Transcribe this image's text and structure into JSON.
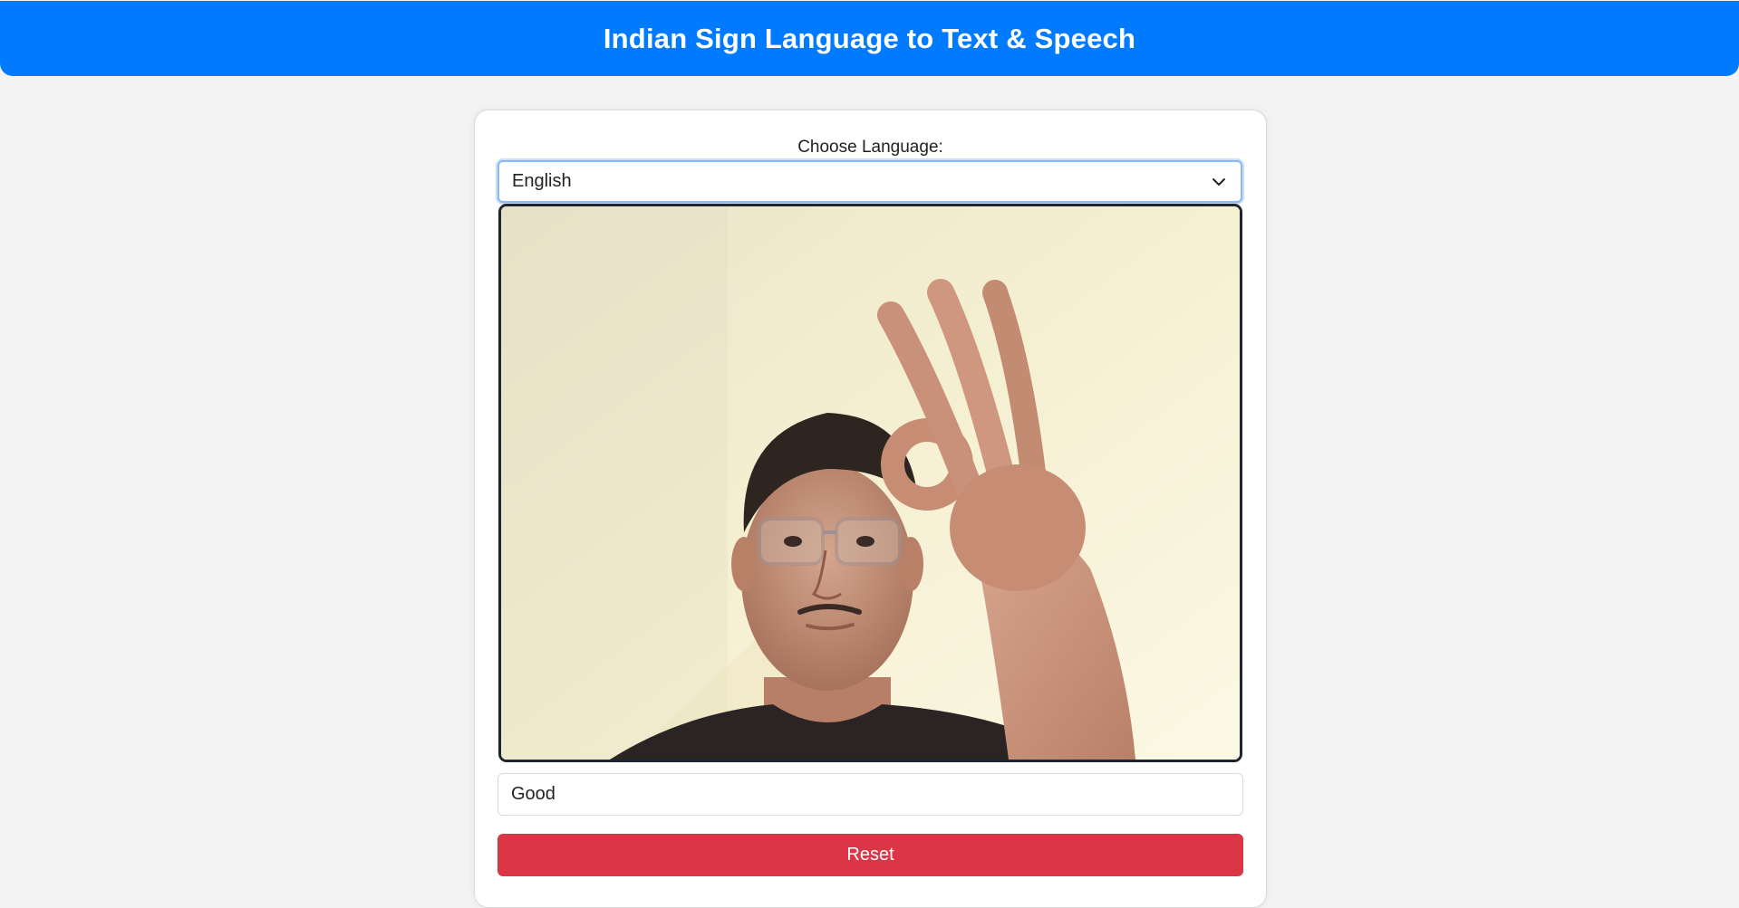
{
  "header": {
    "title": "Indian Sign Language to Text & Speech"
  },
  "language": {
    "label": "Choose Language:",
    "selected": "English"
  },
  "output": {
    "text": "Good"
  },
  "actions": {
    "reset_label": "Reset"
  },
  "colors": {
    "header": "#007bff",
    "reset": "#dc3545",
    "background": "#f3f3f3"
  }
}
